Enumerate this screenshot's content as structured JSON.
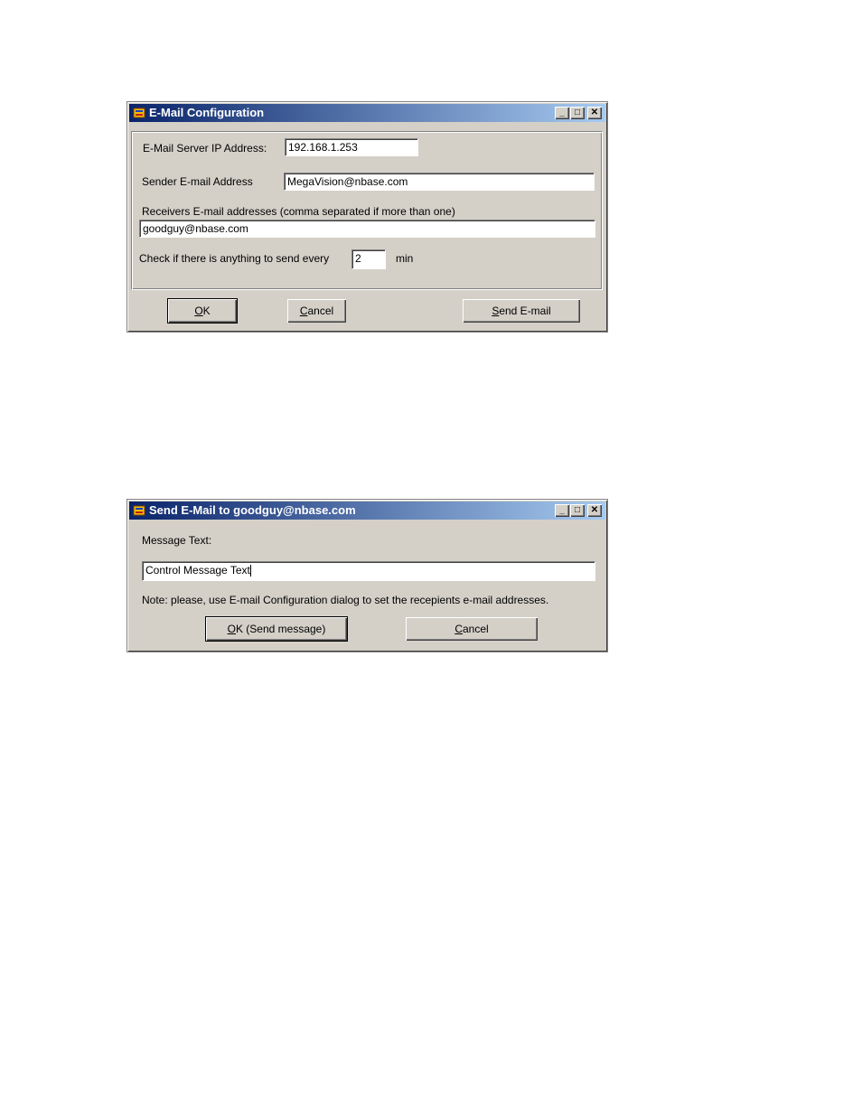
{
  "email_config_dialog": {
    "title": "E-Mail Configuration",
    "server_ip_label": "E-Mail Server IP Address:",
    "server_ip_value": "192.168.1.253",
    "sender_label": "Sender E-mail Address",
    "sender_value": "MegaVision@nbase.com",
    "receivers_label": "Receivers E-mail addresses (comma separated if more than one)",
    "receivers_value": "goodguy@nbase.com",
    "interval_label": "Check if there is anything to send every",
    "interval_value": "2",
    "interval_unit": "min",
    "ok_mnemonic": "O",
    "ok_rest": "K",
    "cancel_mnemonic": "C",
    "cancel_rest": "ancel",
    "send_mnemonic": "S",
    "send_rest": "end E-mail"
  },
  "send_email_dialog": {
    "title": "Send E-Mail to goodguy@nbase.com",
    "message_label": "Message Text:",
    "message_value": "Control Message Text",
    "note": "Note: please, use E-mail Configuration dialog to set the recepients e-mail addresses.",
    "ok_mnemonic": "O",
    "ok_rest": "K (Send message)",
    "cancel_mnemonic": "C",
    "cancel_rest": "ancel"
  },
  "window_controls": {
    "minimize": "_",
    "maximize": "□",
    "close": "✕"
  },
  "colors": {
    "title_start": "#0a246a",
    "title_end": "#a6caf0",
    "dialog_face": "#d4d0c8"
  }
}
